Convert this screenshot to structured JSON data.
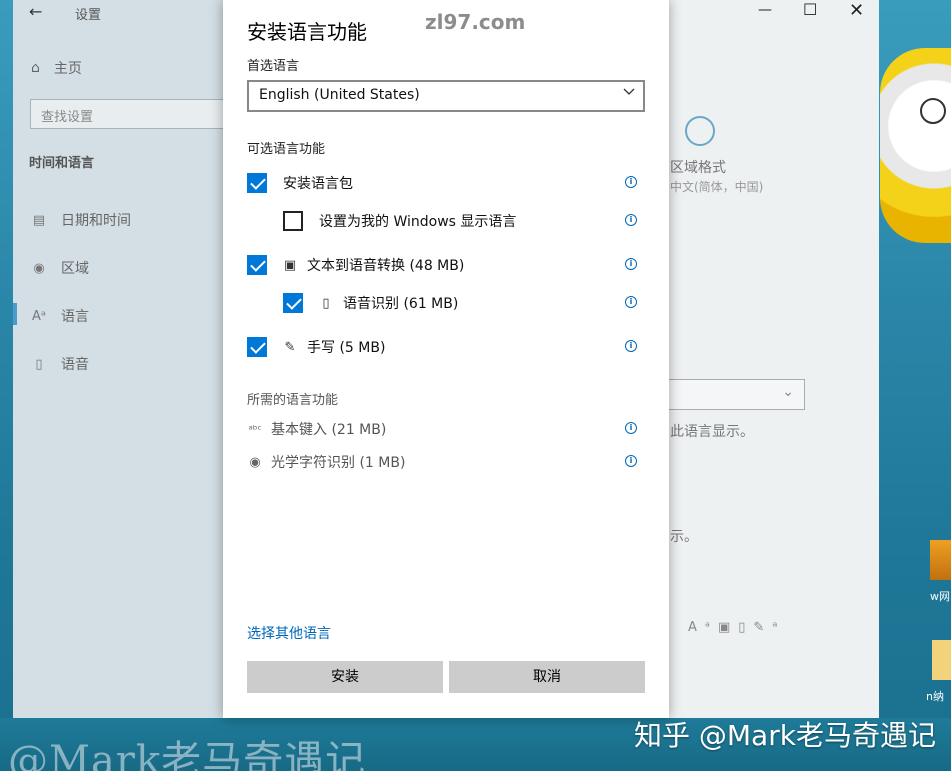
{
  "watermarks": {
    "top": "zl97.com",
    "bottom_left": "@Mark老马奇遇记",
    "bottom_right": "知乎 @Mark老马奇遇记"
  },
  "settings_window": {
    "title": "设置",
    "home_label": "主页",
    "search_placeholder": "查找设置",
    "section_title": "时间和语言",
    "nav_items": [
      {
        "label": "日期和时间",
        "icon": "calendar-clock-icon"
      },
      {
        "label": "区域",
        "icon": "region-globe-icon"
      },
      {
        "label": "语言",
        "icon": "language-icon"
      },
      {
        "label": "语音",
        "icon": "microphone-icon"
      }
    ],
    "selected_nav": "语言",
    "region_tile": {
      "title": "区域格式",
      "subtitle": "中文(简体，中国)"
    },
    "bg_text_1": "此语言显示。",
    "bg_text_2": "示。",
    "window_controls": [
      "minimize",
      "maximize",
      "close"
    ]
  },
  "desktop": {
    "labels": [
      "w网",
      "n纳"
    ]
  },
  "dialog": {
    "title": "安装语言功能",
    "preferred_language_label": "首选语言",
    "preferred_language_value": "English (United States)",
    "optional_section_label": "可选语言功能",
    "options": [
      {
        "label": "安装语言包",
        "checked": true,
        "indent": false,
        "icon": ""
      },
      {
        "label": "设置为我的 Windows 显示语言",
        "checked": false,
        "indent": true,
        "icon": ""
      },
      {
        "label": "文本到语音转换 (48 MB)",
        "checked": true,
        "indent": false,
        "icon": "text-to-speech-icon"
      },
      {
        "label": "语音识别 (61 MB)",
        "checked": true,
        "indent": true,
        "icon": "microphone-icon"
      },
      {
        "label": "手写 (5 MB)",
        "checked": true,
        "indent": false,
        "icon": "handwriting-icon"
      }
    ],
    "required_section_label": "所需的语言功能",
    "required": [
      {
        "label": "基本键入 (21 MB)",
        "icon": "abc-typing-icon"
      },
      {
        "label": "光学字符识别 (1 MB)",
        "icon": "ocr-icon"
      }
    ],
    "other_language_link": "选择其他语言",
    "install_button": "安装",
    "cancel_button": "取消",
    "accent_color": "#0078d7"
  }
}
